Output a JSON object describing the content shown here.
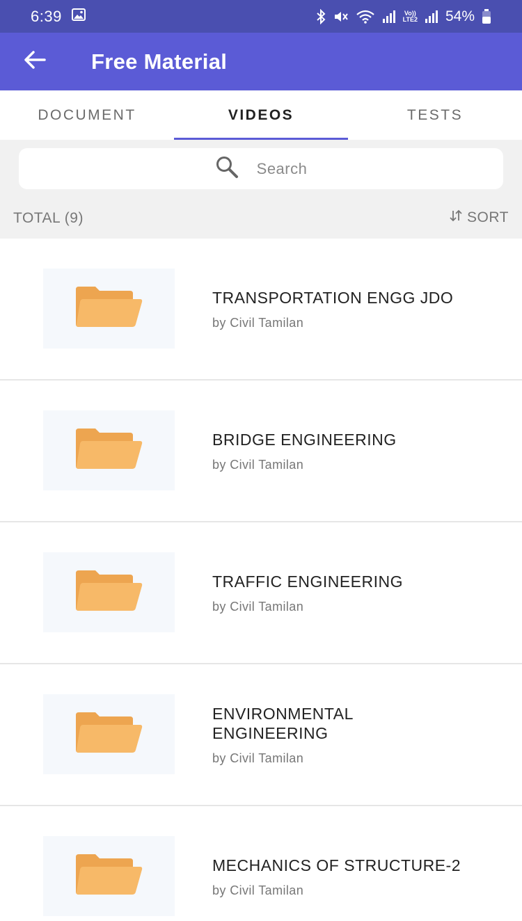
{
  "status_bar": {
    "time": "6:39",
    "lte_top": "Vo))",
    "lte_bottom": "LTE2",
    "battery": "54%"
  },
  "app_bar": {
    "title": "Free Material",
    "back_icon": "arrow-left-icon"
  },
  "tabs": [
    {
      "label": "DOCUMENT",
      "active": false
    },
    {
      "label": "VIDEOS",
      "active": true
    },
    {
      "label": "TESTS",
      "active": false
    }
  ],
  "search": {
    "placeholder": "Search"
  },
  "list_header": {
    "total": "TOTAL (9)",
    "sort": "SORT"
  },
  "items": [
    {
      "title": "TRANSPORTATION ENGG JDO",
      "subtitle": "by Civil Tamilan"
    },
    {
      "title": "BRIDGE ENGINEERING",
      "subtitle": "by Civil Tamilan"
    },
    {
      "title": "TRAFFIC ENGINEERING",
      "subtitle": "by Civil Tamilan"
    },
    {
      "title": "ENVIRONMENTAL ENGINEERING",
      "subtitle": "by Civil Tamilan"
    },
    {
      "title": "MECHANICS OF STRUCTURE-2",
      "subtitle": "by Civil Tamilan"
    }
  ],
  "colors": {
    "status_bar": "#4a4fb0",
    "app_bar": "#5b5bd6",
    "folder_back": "#eda550",
    "folder_front": "#f7b968"
  }
}
